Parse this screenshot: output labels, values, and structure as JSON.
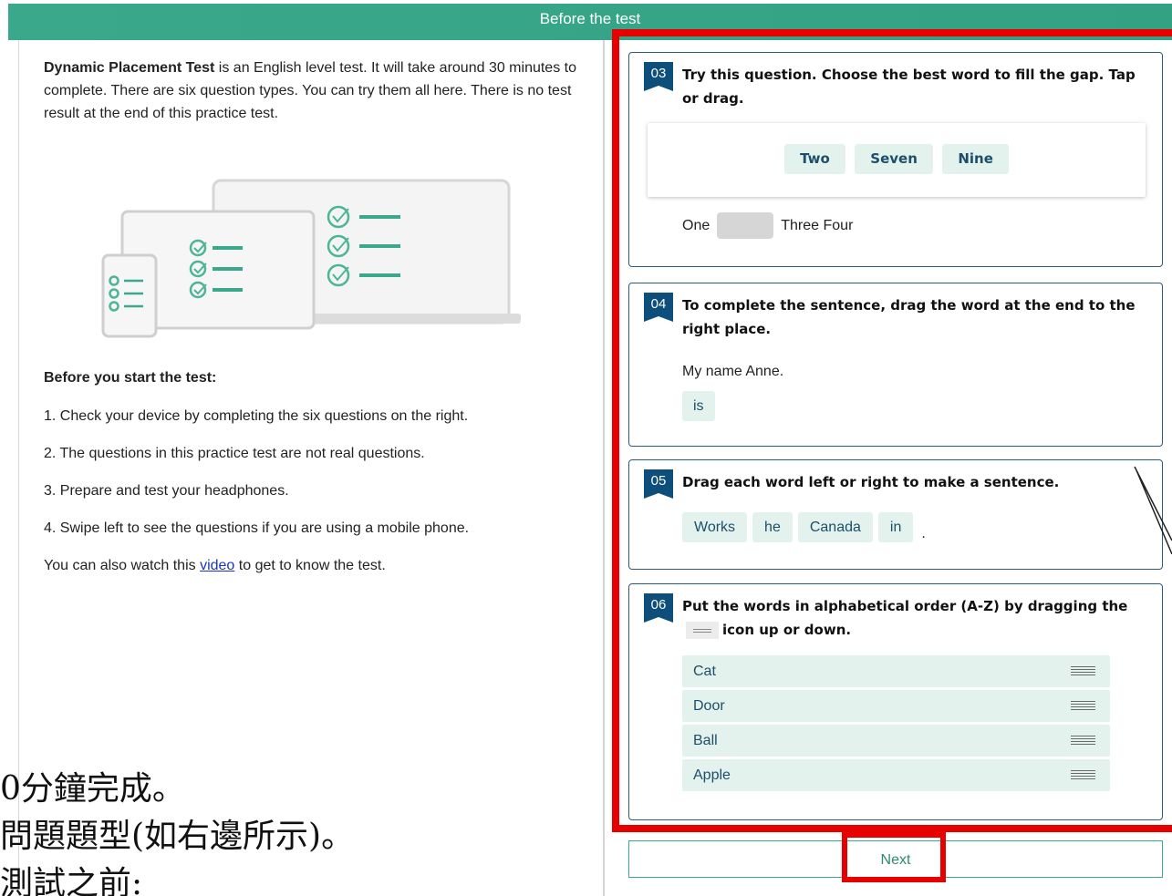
{
  "header": {
    "title": "Before the test"
  },
  "left": {
    "intro_bold": "Dynamic Placement Test",
    "intro_rest": " is an English level test. It will take around 30 minutes to complete. There are six question types. You can try them all here. There is no test result at the end of this practice test.",
    "before_heading": "Before you start the test:",
    "steps": [
      "1. Check your device by completing the six questions on the right.",
      "2. The questions in this practice test are not real questions.",
      "3. Prepare and test your headphones.",
      "4. Swipe left to see the questions if you are using a mobile phone."
    ],
    "video_pre": "You can also watch this ",
    "video_link": "video",
    "video_post": " to get to know the test."
  },
  "overlay_text": {
    "line1": "0分鐘完成。",
    "line2": "問題題型(如右邊所示)。",
    "line3": "測試之前:"
  },
  "q3": {
    "number": "03",
    "text": "Try this question. Choose the best word to fill the gap. Tap or drag.",
    "options": [
      "Two",
      "Seven",
      "Nine"
    ],
    "before_gap": "One",
    "after_gap": "Three Four"
  },
  "q4": {
    "number": "04",
    "text": "To complete the sentence, drag the word at the end to the right place.",
    "sentence": "My name Anne.",
    "word": "is"
  },
  "q5": {
    "number": "05",
    "text": "Drag each word left or right to make a sentence.",
    "words": [
      "Works",
      "he",
      "Canada",
      "in"
    ],
    "end": "."
  },
  "q6": {
    "number": "06",
    "text_pre": "Put the words in alphabetical order (A-Z) by dragging the",
    "text_post": "icon up or down.",
    "items": [
      "Cat",
      "Door",
      "Ball",
      "Apple"
    ]
  },
  "footer": {
    "next_label": "Next"
  },
  "colors": {
    "header": "#3aa88b",
    "badge": "#0d4f7a",
    "chip": "#e4f2ee",
    "highlight": "#e60000"
  }
}
